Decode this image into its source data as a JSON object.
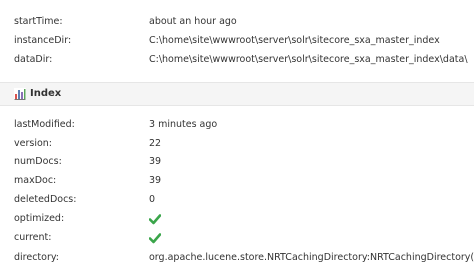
{
  "top_fields": [
    {
      "key": "startTime:",
      "value": "about an hour ago"
    },
    {
      "key": "instanceDir:",
      "value": "C:\\home\\site\\wwwroot\\server\\solr\\sitecore_sxa_master_index"
    },
    {
      "key": "dataDir:",
      "value": "C:\\home\\site\\wwwroot\\server\\solr\\sitecore_sxa_master_index\\data\\"
    }
  ],
  "index_section": {
    "title": "Index",
    "icon": "bar-chart-icon"
  },
  "index_fields": [
    {
      "key": "lastModified:",
      "value": "3 minutes ago"
    },
    {
      "key": "version:",
      "value": "22"
    },
    {
      "key": "numDocs:",
      "value": "39"
    },
    {
      "key": "maxDoc:",
      "value": "39"
    },
    {
      "key": "deletedDocs:",
      "value": "0"
    },
    {
      "key": "optimized:",
      "value": "true",
      "icon": "check-icon"
    },
    {
      "key": "current:",
      "value": "true",
      "icon": "check-icon"
    },
    {
      "key": "directory:",
      "value": "org.apache.lucene.store.NRTCachingDirectory:NRTCachingDirectory(MM"
    }
  ],
  "colors": {
    "check": "#3aa54a",
    "header_bg": "#f5f5f5",
    "text": "#333333"
  }
}
